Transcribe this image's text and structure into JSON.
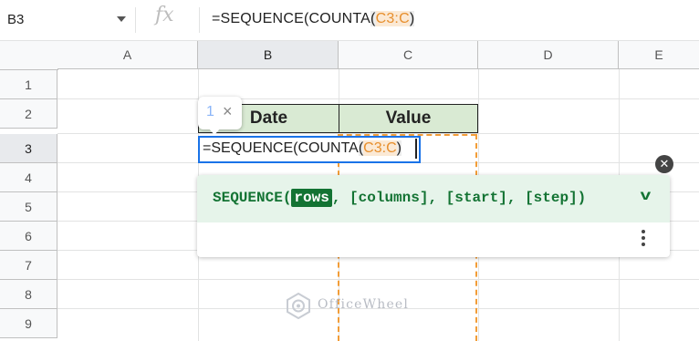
{
  "name_box": {
    "ref": "B3"
  },
  "formula_bar": {
    "fx_icon": "fx",
    "text_prefix": "=SEQUENCE(COUNTA",
    "text_paren_open": "(",
    "text_ref": "C3:C",
    "text_paren_close": ")"
  },
  "columns": [
    "A",
    "B",
    "C",
    "D",
    "E"
  ],
  "rows": [
    "1",
    "2",
    "3",
    "4",
    "5",
    "6",
    "7",
    "8",
    "9"
  ],
  "cells": {
    "b2": "Date",
    "c2": "Value"
  },
  "cell_editor": {
    "text_prefix": "=SEQUENCE(COUNTA",
    "text_paren_open": "(",
    "text_ref": "C3:C",
    "text_paren_close": ")"
  },
  "range_bubble": {
    "count": "1",
    "close": "×"
  },
  "function_help": {
    "fn_name": "SEQUENCE(",
    "active_arg": "rows",
    "rest": ", [columns], [start], [step])",
    "expand_icon": "chevron-down-icon",
    "more_icon": "more-vert-icon",
    "close_icon": "close-icon",
    "chevron_glyph": "v"
  },
  "watermark": {
    "text": "OfficeWheel"
  },
  "colors": {
    "header_fill": "#d9ead3",
    "range_highlight": "#f29d38",
    "active_border": "#1a73e8",
    "help_band": "#e6f4ea",
    "help_text": "#137333"
  }
}
